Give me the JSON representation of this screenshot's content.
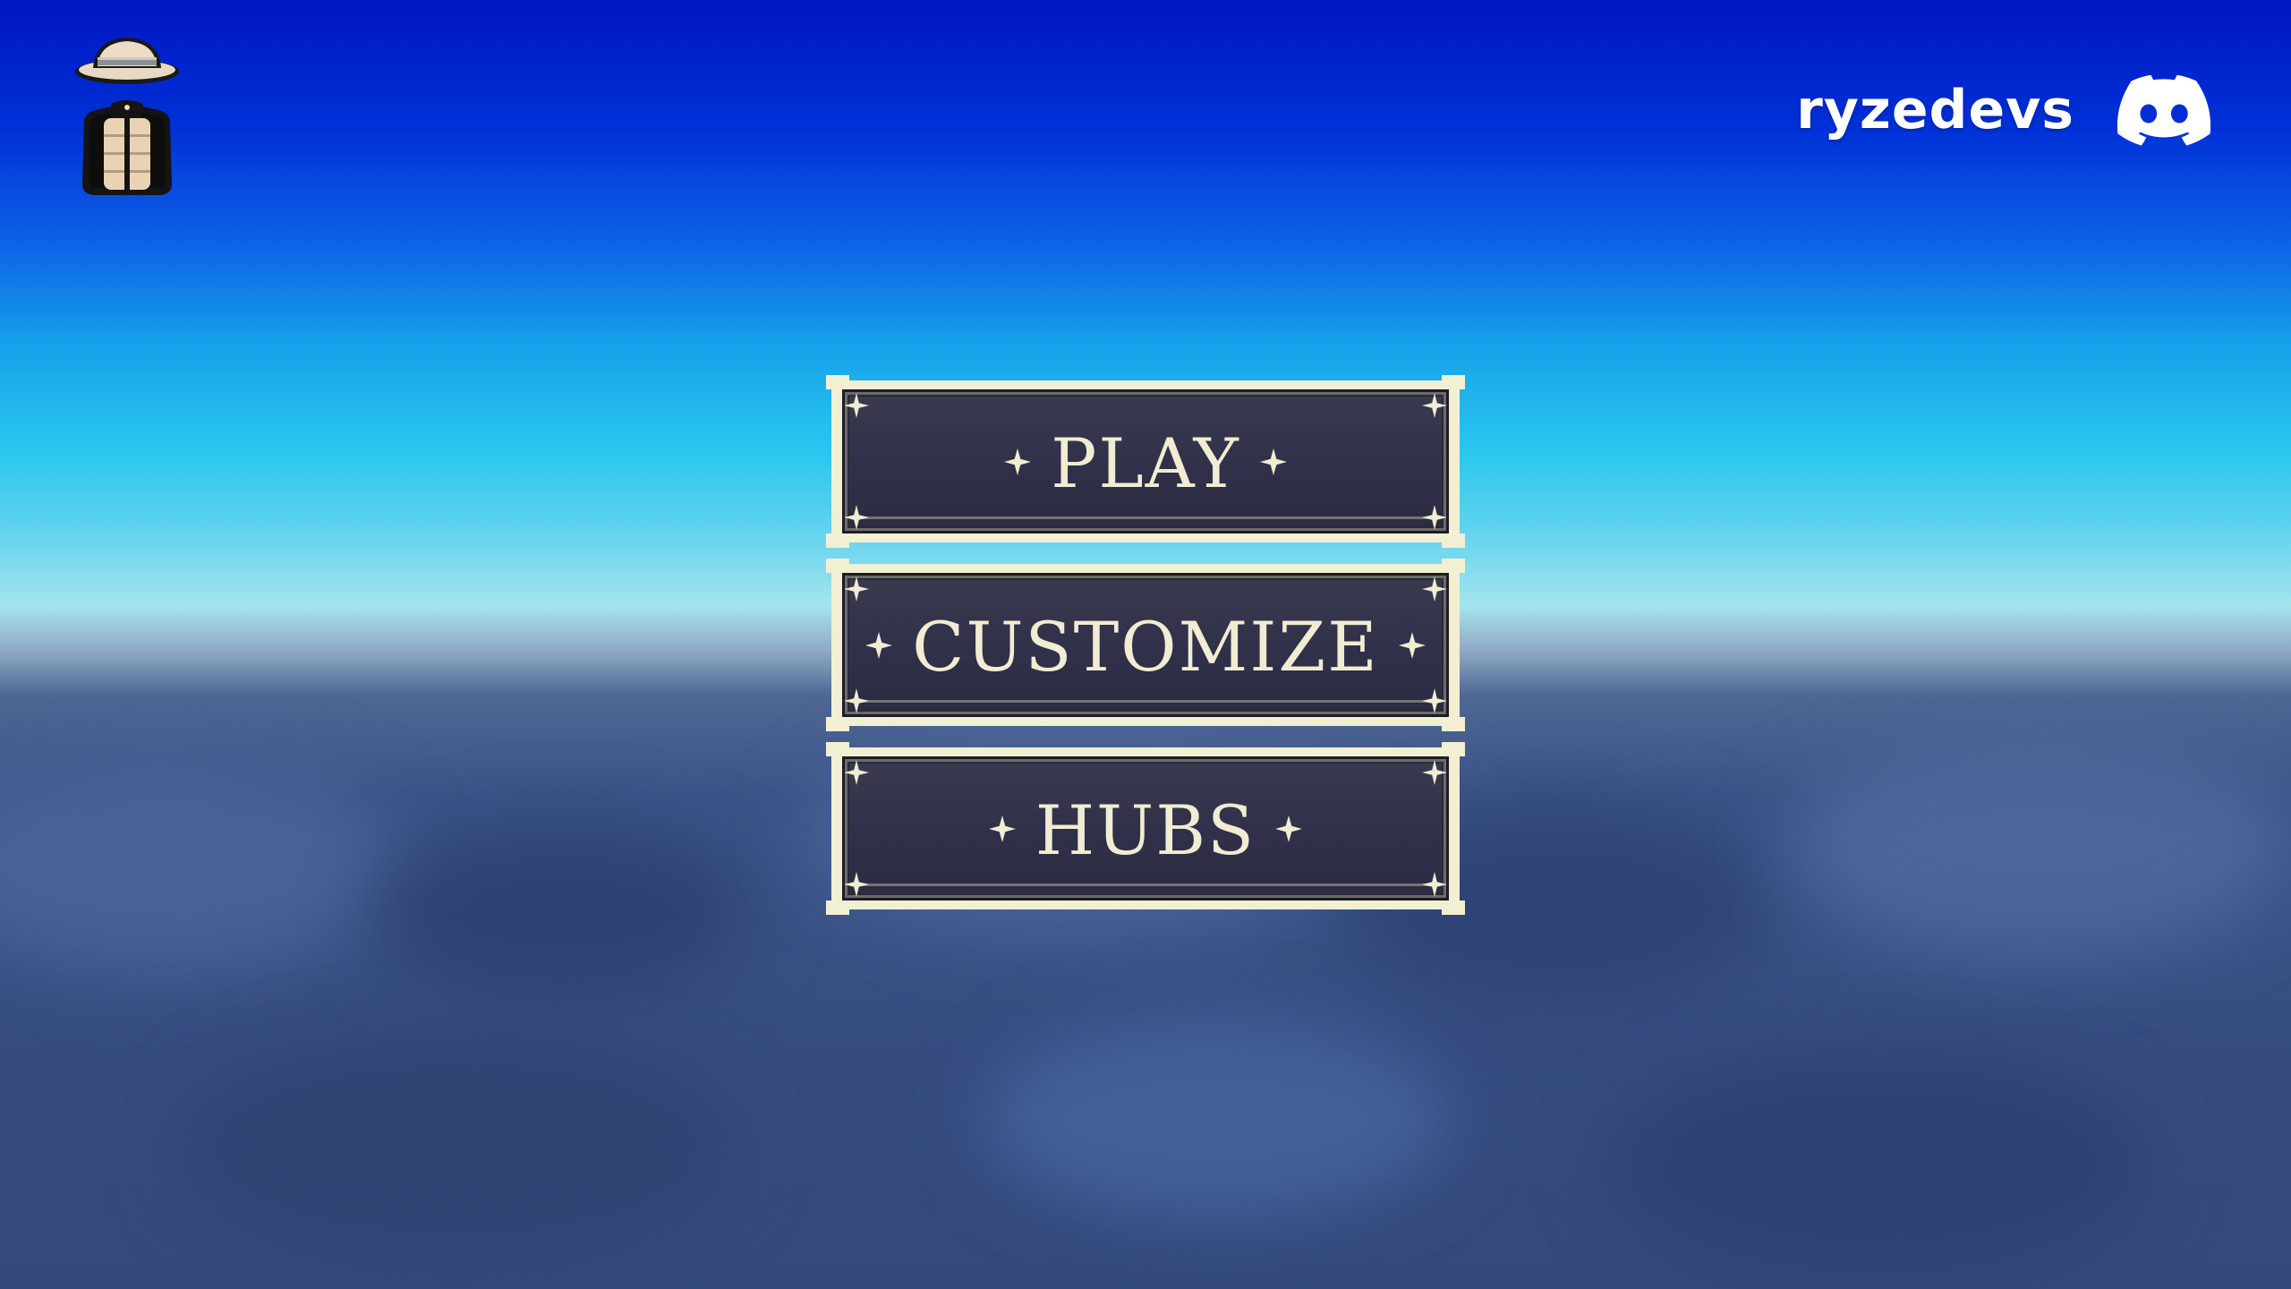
{
  "user": {
    "name": "ryzedevs"
  },
  "icons": {
    "avatar": "avatar-hat-jacket-icon",
    "discord": "discord-icon",
    "sparkle": "four-point-star-icon"
  },
  "menu": {
    "items": [
      {
        "label": "PLAY"
      },
      {
        "label": "CUSTOMIZE"
      },
      {
        "label": "HUBS"
      }
    ]
  },
  "colors": {
    "button_face": "#30304a",
    "button_frame": "#f3efd2",
    "button_text": "#f1ecd2",
    "sky_top": "#0016c0",
    "sky_horizon": "#a5e4ee",
    "ground": "#3a5285"
  }
}
